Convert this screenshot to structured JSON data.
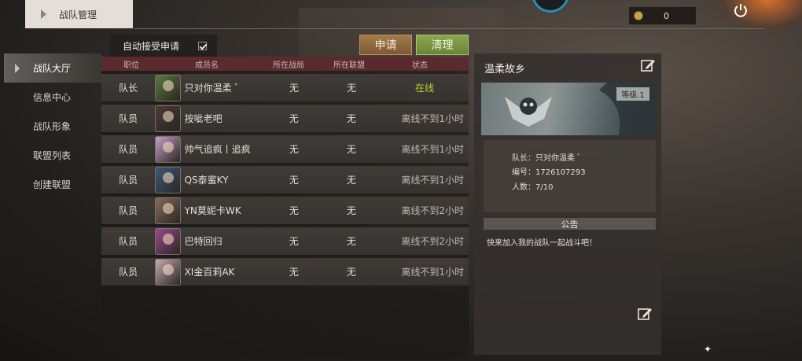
{
  "header": {
    "tab_label": "战队管理"
  },
  "currency": {
    "amount": "0"
  },
  "controls": {
    "auto_accept_label": "自动接受申请",
    "auto_accept_checked": true,
    "apply_label": "申请",
    "clean_label": "清理"
  },
  "sidebar": {
    "items": [
      {
        "label": "战队大厅",
        "active": true
      },
      {
        "label": "信息中心",
        "active": false
      },
      {
        "label": "战队形象",
        "active": false
      },
      {
        "label": "联盟列表",
        "active": false
      },
      {
        "label": "创建联盟",
        "active": false
      }
    ]
  },
  "table": {
    "columns": [
      "职位",
      "成员名",
      "所在战局",
      "所在联盟",
      "状态"
    ],
    "rows": [
      {
        "role": "队长",
        "name": "只对你温柔 ﾞ",
        "match": "无",
        "alliance": "无",
        "status": "在线",
        "online": true,
        "avatar_color": "#5a7a3a"
      },
      {
        "role": "队员",
        "name": "按呲老吧",
        "match": "无",
        "alliance": "无",
        "status": "离线不到1小时",
        "online": false,
        "avatar_color": "#4a3a36"
      },
      {
        "role": "队员",
        "name": "帅气追疯丨追疯",
        "match": "无",
        "alliance": "无",
        "status": "离线不到1小时",
        "online": false,
        "avatar_color": "#c8a0c8"
      },
      {
        "role": "队员",
        "name": "QS泰蜜KY",
        "match": "无",
        "alliance": "无",
        "status": "离线不到1小时",
        "online": false,
        "avatar_color": "#3a5a7a"
      },
      {
        "role": "队员",
        "name": "YN莫妮卡WK",
        "match": "无",
        "alliance": "无",
        "status": "离线不到2小时",
        "online": false,
        "avatar_color": "#8a6a5a"
      },
      {
        "role": "队员",
        "name": "巴特回归",
        "match": "无",
        "alliance": "无",
        "status": "离线不到2小时",
        "online": false,
        "avatar_color": "#9a4a8a"
      },
      {
        "role": "队员",
        "name": "XI金百莉AK",
        "match": "无",
        "alliance": "无",
        "status": "离线不到1小时",
        "online": false,
        "avatar_color": "#c8aab0"
      }
    ]
  },
  "team": {
    "name": "温柔故乡",
    "level": "等级.1",
    "captain": "队长：只对你温柔 ﾞ",
    "id": "编号：1726107293",
    "members": "人数：7/10",
    "notice_title": "公告",
    "notice_text": "快来加入我的战队一起战斗吧！"
  },
  "colors": {
    "online": "#b7d03a",
    "header_bar": "#5a2a2e",
    "apply": "#a47a4a",
    "clean": "#8aa650"
  }
}
